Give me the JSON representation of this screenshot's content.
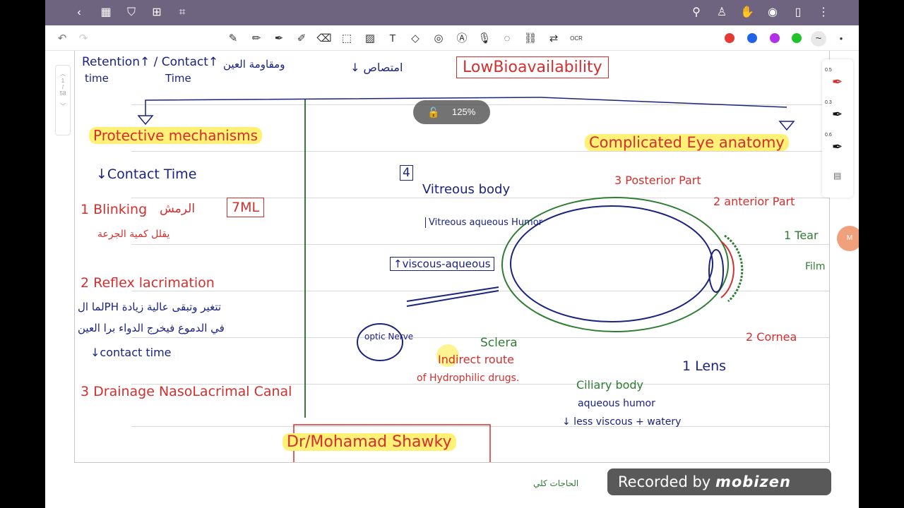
{
  "topbar": {
    "left_icons": [
      "back-chevron-icon",
      "grid-icon",
      "bookmark-icon",
      "add-page-icon",
      "crop-icon"
    ],
    "right_icons": [
      "search-icon",
      "shirt-icon",
      "hand-icon",
      "eye-icon",
      "reading-mode-icon",
      "more-icon"
    ]
  },
  "toolbar": {
    "tools": [
      "undo",
      "redo",
      "pen",
      "pencil",
      "marker",
      "highlighter",
      "eraser",
      "lasso",
      "image",
      "text",
      "shapes",
      "stamp",
      "ocr-text",
      "mic",
      "sticker",
      "link",
      "translate",
      "ocr"
    ],
    "colors": [
      "#e53935",
      "#1e63e9",
      "#b12fe8",
      "#21c32a"
    ],
    "ocr_label": "OCR"
  },
  "zoom": {
    "value": "125%"
  },
  "page_nav": {
    "current": "1",
    "separator": "/",
    "total": "58"
  },
  "pen_panel": {
    "sizes": [
      "0.5",
      "0.3",
      "0.6"
    ]
  },
  "notes": {
    "top_line": {
      "retention": "Retention↑ / Contact↑",
      "time_a": "time",
      "time_b": "Time",
      "arabic_1": "ومقاومة العين",
      "arrow_text": "↓ امتصاص",
      "low_bio": "LowBioavailability"
    },
    "left": {
      "heading": "Protective mechanisms",
      "contact": "↓Contact Time",
      "item1": "1 Blinking",
      "item1_ar": "الرمش",
      "item1_box": "7ML",
      "item1_note": "يقلل كمية الجرعة",
      "item2": "2 Reflex lacrimation",
      "item2_ar1": "لما الPH تتغير وتبقى عالية زيادة",
      "item2_ar2": "في الدموع فيخرج الدواء برا العين",
      "item2_ct": "↓contact time",
      "item3": "3 Drainage NasoLacrimal Canal"
    },
    "right": {
      "heading": "Complicated Eye anatomy",
      "n4": "4",
      "vitreous_body": "Vitreous body",
      "vitreous_humor": "Vitreous aqueous Humor",
      "viscous": "↑viscous-aqueous",
      "optic_nerve": "optic Nerve",
      "posterior": "3 Posterior Part",
      "anterior": "2 anterior Part",
      "tear": "1 Tear",
      "film": "Film",
      "cornea": "2 Cornea",
      "lens": "1 Lens",
      "sclera": "Sclera",
      "indirect": "Indirect route",
      "hydrophilic": "of Hydrophilic drugs.",
      "ciliary": "Ciliary body",
      "aqueous": "aqueous humor",
      "less_viscous": "↓ less viscous + watery"
    },
    "footer_name": "Dr/Mohamad Shawky",
    "bottom_ar": "الحاجات كلي"
  },
  "recorded": {
    "text": "Recorded by",
    "brand": "mobizen"
  },
  "avatar": {
    "text": "M"
  }
}
